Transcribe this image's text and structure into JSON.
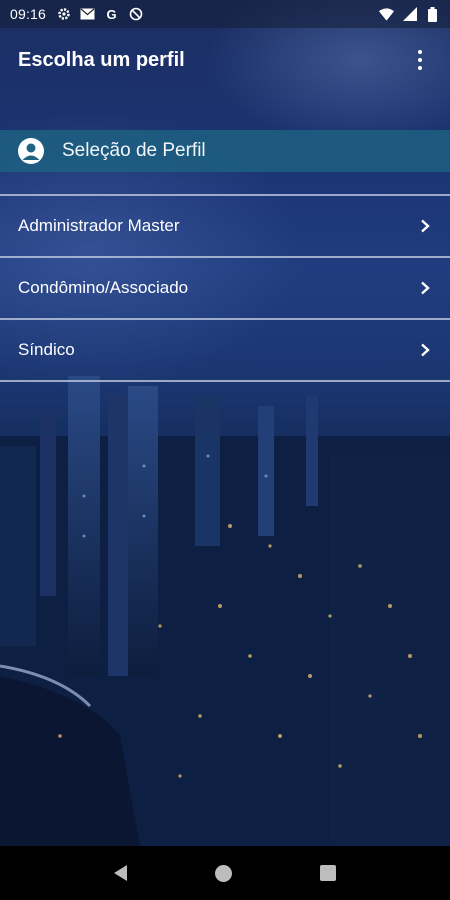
{
  "status_bar": {
    "time": "09:16",
    "left_icons": [
      "gear-icon",
      "mail-icon",
      "google-icon",
      "no-signal-icon"
    ],
    "right_icons": [
      "wifi-icon",
      "cellular-icon",
      "battery-icon"
    ],
    "google_glyph": "G"
  },
  "app_bar": {
    "title": "Escolha um perfil",
    "menu_icon": "more-vert-icon"
  },
  "section": {
    "label": "Seleção de Perfil",
    "icon": "user-avatar-icon",
    "color": "#1e6482"
  },
  "profiles": [
    {
      "label": "Administrador Master"
    },
    {
      "label": "Condômino/Associado"
    },
    {
      "label": "Síndico"
    }
  ],
  "nav_bar": {
    "icons": [
      "back-icon",
      "home-icon",
      "recents-icon"
    ]
  }
}
